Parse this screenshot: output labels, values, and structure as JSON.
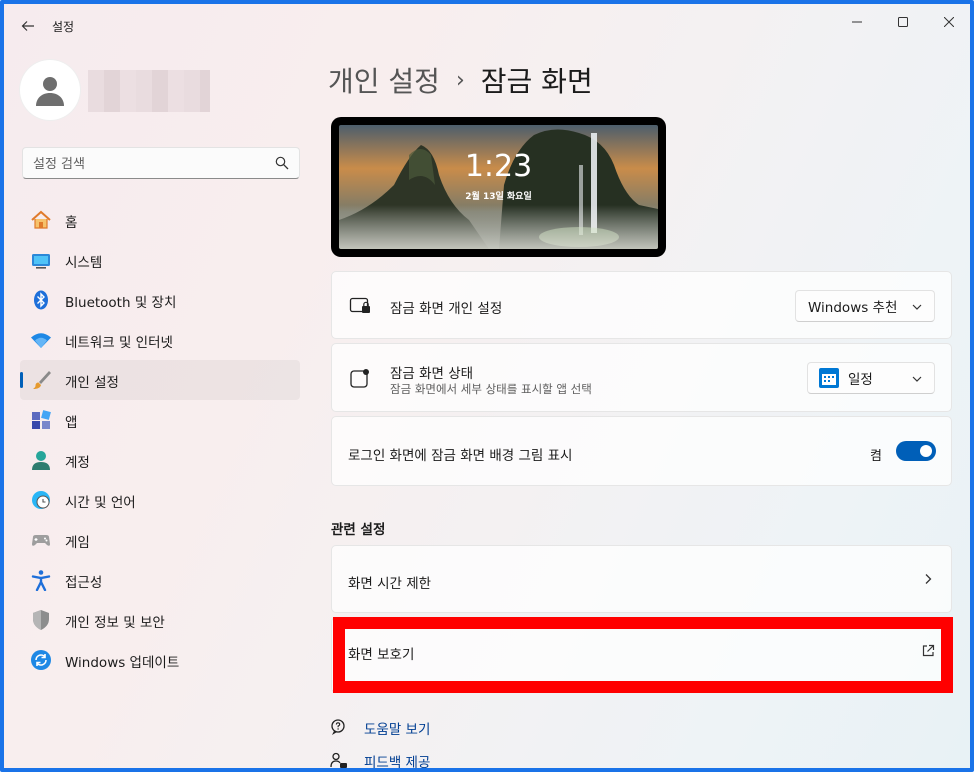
{
  "window": {
    "app_title": "설정",
    "border_color": "#1a73e8",
    "accent_color": "#005fb8"
  },
  "sidebar": {
    "search_placeholder": "설정 검색",
    "items": [
      {
        "label": "홈",
        "icon": "home-icon"
      },
      {
        "label": "시스템",
        "icon": "system-display-icon"
      },
      {
        "label": "Bluetooth 및 장치",
        "icon": "bluetooth-icon"
      },
      {
        "label": "네트워크 및 인터넷",
        "icon": "wifi-icon"
      },
      {
        "label": "개인 설정",
        "icon": "paintbrush-icon",
        "selected": true
      },
      {
        "label": "앱",
        "icon": "apps-icon"
      },
      {
        "label": "계정",
        "icon": "account-icon"
      },
      {
        "label": "시간 및 언어",
        "icon": "clock-globe-icon"
      },
      {
        "label": "게임",
        "icon": "gamepad-icon"
      },
      {
        "label": "접근성",
        "icon": "accessibility-icon"
      },
      {
        "label": "개인 정보 및 보안",
        "icon": "shield-icon"
      },
      {
        "label": "Windows 업데이트",
        "icon": "update-icon"
      }
    ]
  },
  "main": {
    "breadcrumb_parent": "개인 설정",
    "breadcrumb_separator": "›",
    "breadcrumb_current": "잠금 화면",
    "preview": {
      "time": "1:23",
      "date": "2월 13일 화요일"
    },
    "lock_personalize": {
      "title": "잠금 화면 개인 설정",
      "value": "Windows 추천"
    },
    "lock_status": {
      "title": "잠금 화면 상태",
      "subtitle": "잠금 화면에서 세부 상태를 표시할 앱 선택",
      "value": "일정"
    },
    "signin_background": {
      "title": "로그인 화면에 잠금 화면 배경 그림 표시",
      "state_label": "켬",
      "on": true
    },
    "related": {
      "title": "관련 설정",
      "screen_timeout": "화면 시간 제한",
      "screen_saver": "화면 보호기"
    },
    "help": {
      "get_help": "도움말 보기",
      "feedback": "피드백 제공"
    },
    "highlight_color": "#ff0000"
  }
}
